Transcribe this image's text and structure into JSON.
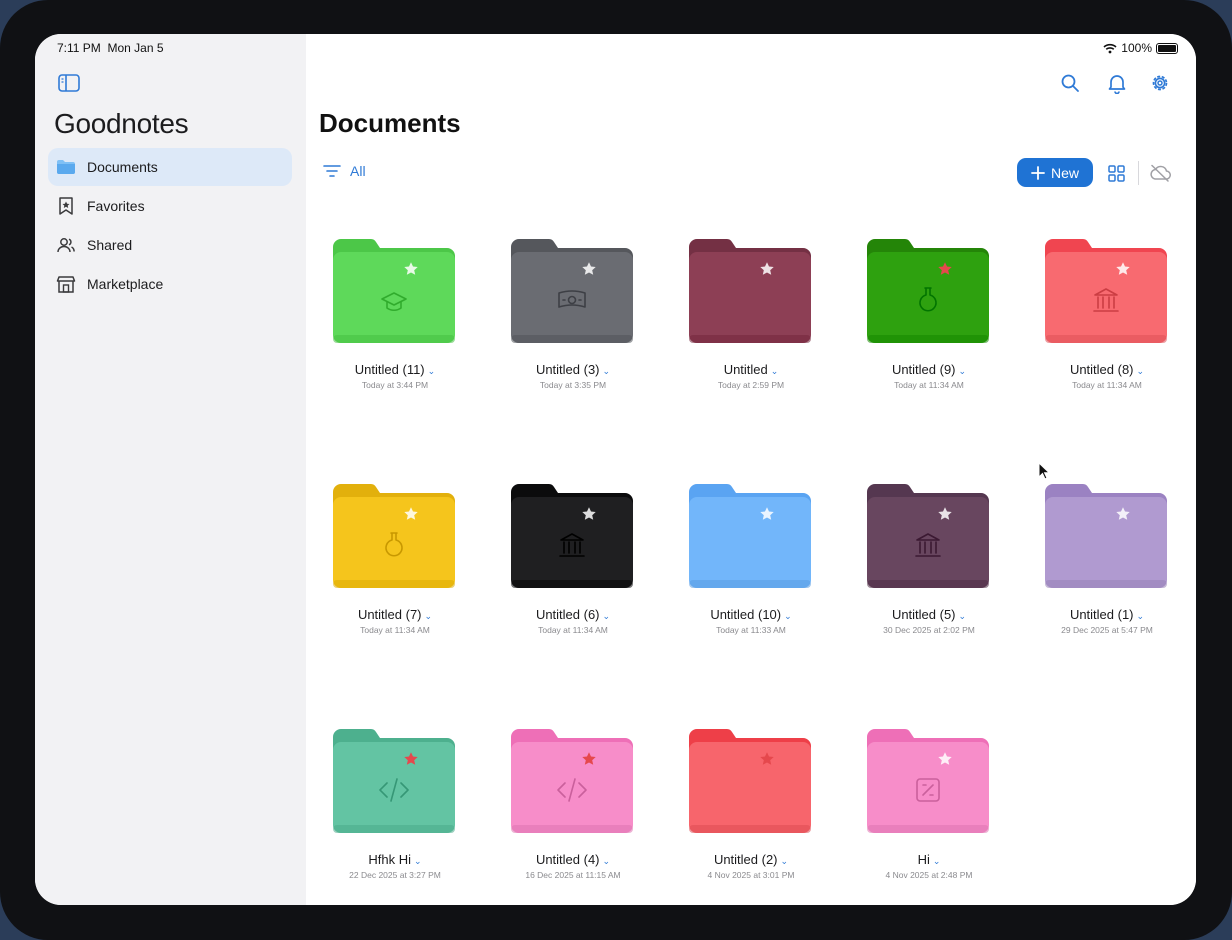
{
  "status_bar": {
    "time": "7:11 PM",
    "date": "Mon Jan 5",
    "battery": "100%"
  },
  "sidebar": {
    "app_title": "Goodnotes",
    "items": [
      {
        "label": "Documents",
        "icon": "folder-icon",
        "active": true
      },
      {
        "label": "Favorites",
        "icon": "bookmark-star-icon",
        "active": false
      },
      {
        "label": "Shared",
        "icon": "people-icon",
        "active": false
      },
      {
        "label": "Marketplace",
        "icon": "store-icon",
        "active": false
      }
    ]
  },
  "main": {
    "page_title": "Documents",
    "filter_label": "All",
    "new_label": "New",
    "folders": [
      {
        "name": "Untitled (11)",
        "date": "Today at 3:44 PM",
        "color": "#5ed95a",
        "tab": "#4cc748",
        "icon": "graduation-cap-icon",
        "favorite": false
      },
      {
        "name": "Untitled (3)",
        "date": "Today at 3:35 PM",
        "color": "#6a6c72",
        "tab": "#55575c",
        "icon": "money-icon",
        "favorite": false
      },
      {
        "name": "Untitled",
        "date": "Today at 2:59 PM",
        "color": "#8d3f55",
        "tab": "#743044",
        "icon": "none",
        "favorite": false
      },
      {
        "name": "Untitled (9)",
        "date": "Today at 11:34 AM",
        "color": "#2ea10f",
        "tab": "#248508",
        "icon": "flask-icon",
        "favorite": true
      },
      {
        "name": "Untitled (8)",
        "date": "Today at 11:34 AM",
        "color": "#f86a70",
        "tab": "#f04550",
        "icon": "bank-icon",
        "favorite": false
      },
      {
        "name": "Untitled (7)",
        "date": "Today at 11:34 AM",
        "color": "#f5c51c",
        "tab": "#e2b00c",
        "icon": "flask-icon",
        "favorite": false
      },
      {
        "name": "Untitled (6)",
        "date": "Today at 11:34 AM",
        "color": "#1f1f21",
        "tab": "#0b0b0c",
        "icon": "bank-icon",
        "favorite": false
      },
      {
        "name": "Untitled (10)",
        "date": "Today at 11:33 AM",
        "color": "#72b6fa",
        "tab": "#5aa4f2",
        "icon": "none",
        "favorite": false
      },
      {
        "name": "Untitled (5)",
        "date": "30 Dec 2025 at 2:02 PM",
        "color": "#68465f",
        "tab": "#553750",
        "icon": "bank-icon",
        "favorite": false
      },
      {
        "name": "Untitled (1)",
        "date": "29 Dec 2025 at 5:47 PM",
        "color": "#b09ad0",
        "tab": "#9b82c2",
        "icon": "none",
        "favorite": false
      },
      {
        "name": "Hfhk Hi",
        "date": "22 Dec 2025 at 3:27 PM",
        "color": "#63c4a3",
        "tab": "#4db08e",
        "icon": "code-icon",
        "favorite": true
      },
      {
        "name": "Untitled (4)",
        "date": "16 Dec 2025 at 11:15 AM",
        "color": "#f78dc9",
        "tab": "#ee6fb7",
        "icon": "code-icon",
        "favorite": true
      },
      {
        "name": "Untitled (2)",
        "date": "4 Nov 2025 at 3:01 PM",
        "color": "#f7656c",
        "tab": "#ee3f48",
        "icon": "none",
        "favorite": true
      },
      {
        "name": "Hi",
        "date": "4 Nov 2025 at 2:48 PM",
        "color": "#f78dc9",
        "tab": "#ee6fb7",
        "icon": "percent-icon",
        "favorite": false
      }
    ]
  }
}
